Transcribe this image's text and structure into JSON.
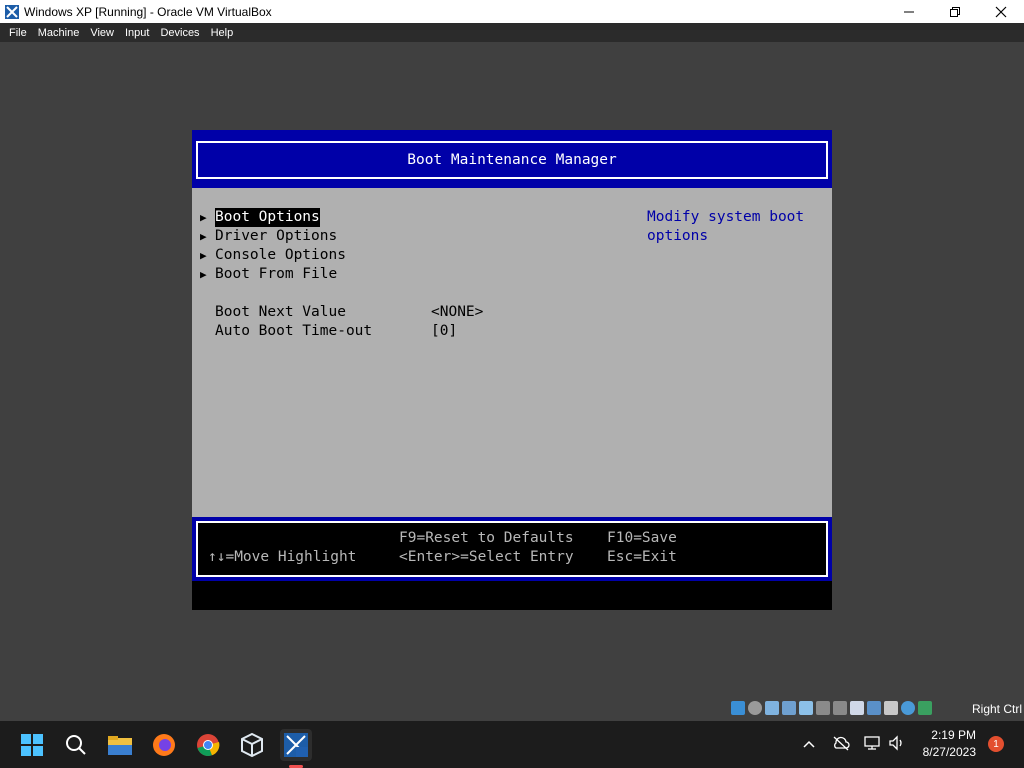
{
  "window": {
    "title": "Windows XP  [Running] - Oracle VM VirtualBox",
    "minimize_icon": "minimize-icon",
    "maximize_icon": "restore-icon",
    "close_icon": "close-icon"
  },
  "menubar": [
    "File",
    "Machine",
    "View",
    "Input",
    "Devices",
    "Help"
  ],
  "bios": {
    "title": "Boot Maintenance Manager",
    "menu_items": [
      "Boot Options",
      "Driver Options",
      "Console Options",
      "Boot From File"
    ],
    "settings": [
      {
        "label": "Boot Next Value",
        "value": "<NONE>"
      },
      {
        "label": "Auto Boot Time-out",
        "value": "[0]"
      }
    ],
    "help_line1": "Modify system boot",
    "help_line2": "options",
    "footer": {
      "reset": "F9=Reset to Defaults",
      "save": "F10=Save",
      "move": "↑↓=Move Highlight",
      "select": "<Enter>=Select Entry",
      "exit": "Esc=Exit"
    }
  },
  "statusbar": {
    "host_key": "Right Ctrl"
  },
  "taskbar": {
    "apps": [
      "start-icon",
      "search-icon",
      "file-explorer-icon",
      "firefox-icon",
      "chrome-icon",
      "virtualbox-icon",
      "windows-xp-vm-icon"
    ],
    "time": "2:19 PM",
    "date": "8/27/2023",
    "notification_count": "1"
  },
  "colors": {
    "bios_blue": "#0000a8",
    "bios_gray": "#b0b0b0",
    "vm_background": "#404040"
  }
}
